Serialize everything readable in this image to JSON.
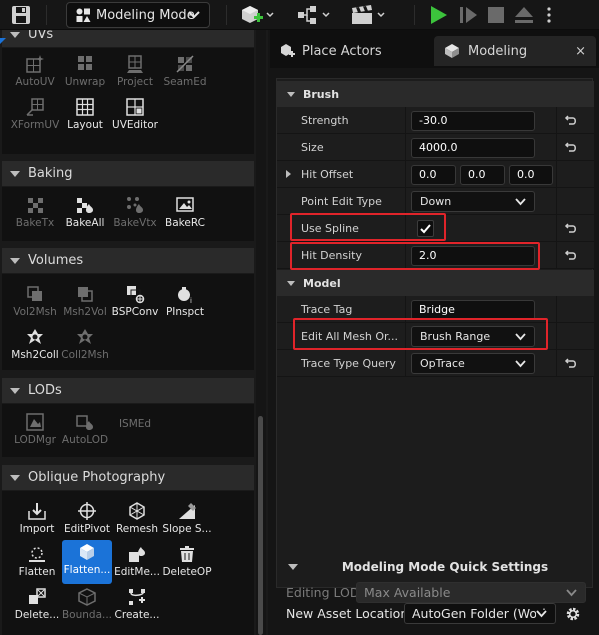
{
  "toolbar": {
    "mode_label": "Modeling Mode",
    "icons": [
      "save-icon",
      "modes-icon",
      "add-content-icon",
      "blueprint-icon",
      "cinematics-icon",
      "play-icon",
      "advance-frame-icon",
      "stop-icon",
      "eject-icon",
      "more-options-icon"
    ]
  },
  "left": {
    "sections": [
      {
        "title": "UVs",
        "tools": [
          {
            "label": "AutoUV",
            "enabled": false
          },
          {
            "label": "Unwrap",
            "enabled": false
          },
          {
            "label": "Project",
            "enabled": false
          },
          {
            "label": "SeamEd",
            "enabled": false
          },
          {
            "label": "XFormUV",
            "enabled": false
          },
          {
            "label": "Layout",
            "enabled": true
          },
          {
            "label": "UVEditor",
            "enabled": true
          }
        ]
      },
      {
        "title": "Baking",
        "tools": [
          {
            "label": "BakeTx",
            "enabled": false
          },
          {
            "label": "BakeAll",
            "enabled": true
          },
          {
            "label": "BakeVtx",
            "enabled": false
          },
          {
            "label": "BakeRC",
            "enabled": true
          }
        ]
      },
      {
        "title": "Volumes",
        "tools": [
          {
            "label": "Vol2Msh",
            "enabled": false
          },
          {
            "label": "Msh2Vol",
            "enabled": false
          },
          {
            "label": "BSPConv",
            "enabled": true
          },
          {
            "label": "PInspct",
            "enabled": true
          },
          {
            "label": "Msh2Coll",
            "enabled": true
          },
          {
            "label": "Coll2Msh",
            "enabled": false
          }
        ]
      },
      {
        "title": "LODs",
        "tools": [
          {
            "label": "LODMgr",
            "enabled": false
          },
          {
            "label": "AutoLOD",
            "enabled": false
          },
          {
            "label": "ISMEd",
            "enabled": false
          }
        ]
      },
      {
        "title": "Oblique Photography",
        "tools": [
          {
            "label": "Import",
            "enabled": true
          },
          {
            "label": "EditPivot",
            "enabled": true
          },
          {
            "label": "Remesh",
            "enabled": true
          },
          {
            "label": "Slope S...",
            "enabled": true
          },
          {
            "label": "Flatten",
            "enabled": true
          },
          {
            "label": "Flatten...",
            "enabled": true,
            "selected": true
          },
          {
            "label": "EditMe...",
            "enabled": true
          },
          {
            "label": "DeleteOP",
            "enabled": true
          },
          {
            "label": "Delete...",
            "enabled": true
          },
          {
            "label": "Bounda...",
            "enabled": false
          },
          {
            "label": "Create...",
            "enabled": true
          }
        ]
      }
    ]
  },
  "tabs": [
    {
      "label": "Place Actors"
    },
    {
      "label": "Modeling",
      "active": true,
      "close": "×"
    }
  ],
  "details": {
    "brush": {
      "title": "Brush",
      "strength_label": "Strength",
      "strength_value": "-30.0",
      "size_label": "Size",
      "size_value": "4000.0",
      "hit_offset_label": "Hit Offset",
      "hit_offset_x": "0.0",
      "hit_offset_y": "0.0",
      "hit_offset_z": "0.0",
      "point_edit_label": "Point Edit Type",
      "point_edit_value": "Down",
      "use_spline_label": "Use Spline",
      "use_spline_checked": true,
      "hit_density_label": "Hit Density",
      "hit_density_value": "2.0"
    },
    "model": {
      "title": "Model",
      "trace_tag_label": "Trace Tag",
      "trace_tag_value": "Bridge",
      "edit_all_label": "Edit All Mesh Or...",
      "edit_all_value": "Brush Range",
      "trace_type_label": "Trace Type Query",
      "trace_type_value": "OpTrace"
    }
  },
  "quick_settings": {
    "title": "Modeling Mode Quick Settings",
    "editing_lod_label": "Editing LOD",
    "editing_lod_value": "Max Available",
    "asset_location_label": "New Asset Location",
    "asset_location_value": "AutoGen Folder (Worl"
  },
  "colors": {
    "accent_blue": "#1b73d8",
    "play_green": "#3cc33c",
    "highlight_red": "#e0242a"
  }
}
